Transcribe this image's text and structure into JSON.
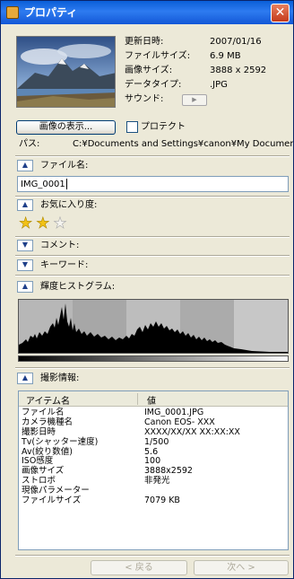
{
  "window": {
    "title": "プロパティ",
    "close_label": "✕"
  },
  "properties": [
    {
      "label": "更新日時:",
      "value": "2007/01/16"
    },
    {
      "label": "ファイルサイズ:",
      "value": "6.9 MB"
    },
    {
      "label": "画像サイズ:",
      "value": "3888 x 2592"
    },
    {
      "label": "データタイプ:",
      "value": ".JPG"
    },
    {
      "label": "サウンド:",
      "value": ""
    }
  ],
  "sound_button_label": "▶",
  "show_image_button": "画像の表示...",
  "protect_label": "プロテクト",
  "path": {
    "label": "パス:",
    "value": "C:¥Documents and Settings¥canon¥My Documents"
  },
  "sections": {
    "filename": {
      "label": "ファイル名:",
      "value": "IMG_0001"
    },
    "rating": {
      "label": "お気に入り度:",
      "value": 2,
      "max": 3
    },
    "comment": {
      "label": "コメント:"
    },
    "keyword": {
      "label": "キーワード:"
    },
    "histogram": {
      "label": "輝度ヒストグラム:"
    },
    "shooting": {
      "label": "撮影情報:"
    }
  },
  "icons": {
    "expand": "▲",
    "collapse": "▼",
    "star": "★"
  },
  "colors": {
    "star_on": "#f2c216",
    "star_off": "#f4f3ee"
  },
  "table": {
    "headers": [
      "アイテム名",
      "値"
    ],
    "rows": [
      [
        "ファイル名",
        "IMG_0001.JPG"
      ],
      [
        "カメラ機種名",
        "Canon EOS- XXX"
      ],
      [
        "撮影日時",
        "XXXX/XX/XX XX:XX:XX"
      ],
      [
        "Tv(シャッター速度)",
        "1/500"
      ],
      [
        "Av(絞り数値)",
        "5.6"
      ],
      [
        "ISO感度",
        "100"
      ],
      [
        "画像サイズ",
        "3888x2592"
      ],
      [
        "ストロボ",
        "非発光"
      ],
      [
        "現像パラメーター",
        ""
      ],
      [
        "ファイルサイズ",
        "7079 KB"
      ],
      [
        "",
        ""
      ],
      [
        "",
        ""
      ],
      [
        "",
        ""
      ],
      [
        "",
        ""
      ]
    ]
  },
  "nav": {
    "prev": "< 戻る",
    "next": "次へ >"
  }
}
